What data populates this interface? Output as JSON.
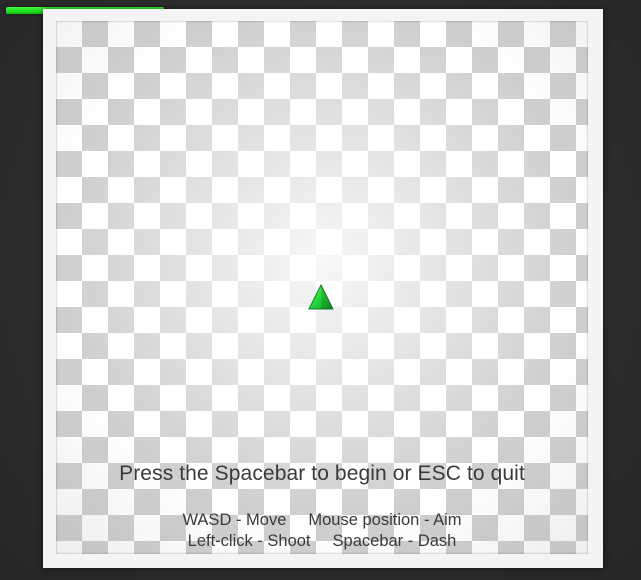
{
  "hud": {
    "health_fraction": 1.0,
    "health_color": "#18e018"
  },
  "player": {
    "icon": "triangle-ship-icon",
    "color": "#20cc30"
  },
  "arena": {
    "pattern": "checkerboard",
    "light_color": "#ffffff",
    "dark_color": "#cfcfcf"
  },
  "overlay": {
    "start_prompt": "Press the Spacebar to begin or ESC to quit",
    "controls": [
      [
        "WASD - Move",
        "Mouse position - Aim"
      ],
      [
        "Left-click - Shoot",
        "Spacebar - Dash"
      ]
    ]
  }
}
